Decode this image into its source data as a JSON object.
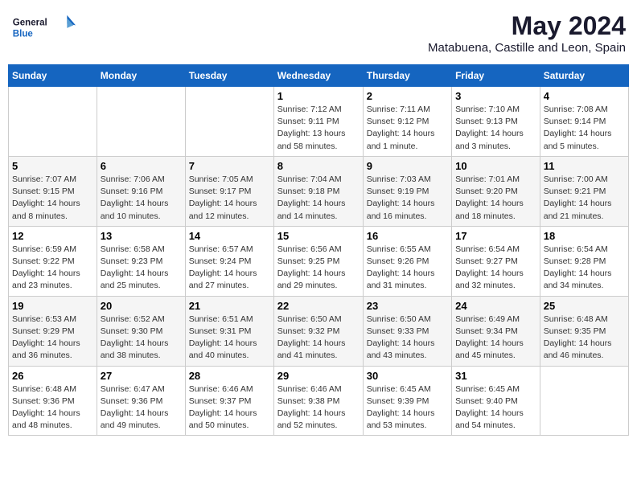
{
  "header": {
    "logo_general": "General",
    "logo_blue": "Blue",
    "title": "May 2024",
    "subtitle": "Matabuena, Castille and Leon, Spain"
  },
  "days_of_week": [
    "Sunday",
    "Monday",
    "Tuesday",
    "Wednesday",
    "Thursday",
    "Friday",
    "Saturday"
  ],
  "weeks": [
    [
      {
        "day": "",
        "sunrise": "",
        "sunset": "",
        "daylight": ""
      },
      {
        "day": "",
        "sunrise": "",
        "sunset": "",
        "daylight": ""
      },
      {
        "day": "",
        "sunrise": "",
        "sunset": "",
        "daylight": ""
      },
      {
        "day": "1",
        "sunrise": "Sunrise: 7:12 AM",
        "sunset": "Sunset: 9:11 PM",
        "daylight": "Daylight: 13 hours and 58 minutes."
      },
      {
        "day": "2",
        "sunrise": "Sunrise: 7:11 AM",
        "sunset": "Sunset: 9:12 PM",
        "daylight": "Daylight: 14 hours and 1 minute."
      },
      {
        "day": "3",
        "sunrise": "Sunrise: 7:10 AM",
        "sunset": "Sunset: 9:13 PM",
        "daylight": "Daylight: 14 hours and 3 minutes."
      },
      {
        "day": "4",
        "sunrise": "Sunrise: 7:08 AM",
        "sunset": "Sunset: 9:14 PM",
        "daylight": "Daylight: 14 hours and 5 minutes."
      }
    ],
    [
      {
        "day": "5",
        "sunrise": "Sunrise: 7:07 AM",
        "sunset": "Sunset: 9:15 PM",
        "daylight": "Daylight: 14 hours and 8 minutes."
      },
      {
        "day": "6",
        "sunrise": "Sunrise: 7:06 AM",
        "sunset": "Sunset: 9:16 PM",
        "daylight": "Daylight: 14 hours and 10 minutes."
      },
      {
        "day": "7",
        "sunrise": "Sunrise: 7:05 AM",
        "sunset": "Sunset: 9:17 PM",
        "daylight": "Daylight: 14 hours and 12 minutes."
      },
      {
        "day": "8",
        "sunrise": "Sunrise: 7:04 AM",
        "sunset": "Sunset: 9:18 PM",
        "daylight": "Daylight: 14 hours and 14 minutes."
      },
      {
        "day": "9",
        "sunrise": "Sunrise: 7:03 AM",
        "sunset": "Sunset: 9:19 PM",
        "daylight": "Daylight: 14 hours and 16 minutes."
      },
      {
        "day": "10",
        "sunrise": "Sunrise: 7:01 AM",
        "sunset": "Sunset: 9:20 PM",
        "daylight": "Daylight: 14 hours and 18 minutes."
      },
      {
        "day": "11",
        "sunrise": "Sunrise: 7:00 AM",
        "sunset": "Sunset: 9:21 PM",
        "daylight": "Daylight: 14 hours and 21 minutes."
      }
    ],
    [
      {
        "day": "12",
        "sunrise": "Sunrise: 6:59 AM",
        "sunset": "Sunset: 9:22 PM",
        "daylight": "Daylight: 14 hours and 23 minutes."
      },
      {
        "day": "13",
        "sunrise": "Sunrise: 6:58 AM",
        "sunset": "Sunset: 9:23 PM",
        "daylight": "Daylight: 14 hours and 25 minutes."
      },
      {
        "day": "14",
        "sunrise": "Sunrise: 6:57 AM",
        "sunset": "Sunset: 9:24 PM",
        "daylight": "Daylight: 14 hours and 27 minutes."
      },
      {
        "day": "15",
        "sunrise": "Sunrise: 6:56 AM",
        "sunset": "Sunset: 9:25 PM",
        "daylight": "Daylight: 14 hours and 29 minutes."
      },
      {
        "day": "16",
        "sunrise": "Sunrise: 6:55 AM",
        "sunset": "Sunset: 9:26 PM",
        "daylight": "Daylight: 14 hours and 31 minutes."
      },
      {
        "day": "17",
        "sunrise": "Sunrise: 6:54 AM",
        "sunset": "Sunset: 9:27 PM",
        "daylight": "Daylight: 14 hours and 32 minutes."
      },
      {
        "day": "18",
        "sunrise": "Sunrise: 6:54 AM",
        "sunset": "Sunset: 9:28 PM",
        "daylight": "Daylight: 14 hours and 34 minutes."
      }
    ],
    [
      {
        "day": "19",
        "sunrise": "Sunrise: 6:53 AM",
        "sunset": "Sunset: 9:29 PM",
        "daylight": "Daylight: 14 hours and 36 minutes."
      },
      {
        "day": "20",
        "sunrise": "Sunrise: 6:52 AM",
        "sunset": "Sunset: 9:30 PM",
        "daylight": "Daylight: 14 hours and 38 minutes."
      },
      {
        "day": "21",
        "sunrise": "Sunrise: 6:51 AM",
        "sunset": "Sunset: 9:31 PM",
        "daylight": "Daylight: 14 hours and 40 minutes."
      },
      {
        "day": "22",
        "sunrise": "Sunrise: 6:50 AM",
        "sunset": "Sunset: 9:32 PM",
        "daylight": "Daylight: 14 hours and 41 minutes."
      },
      {
        "day": "23",
        "sunrise": "Sunrise: 6:50 AM",
        "sunset": "Sunset: 9:33 PM",
        "daylight": "Daylight: 14 hours and 43 minutes."
      },
      {
        "day": "24",
        "sunrise": "Sunrise: 6:49 AM",
        "sunset": "Sunset: 9:34 PM",
        "daylight": "Daylight: 14 hours and 45 minutes."
      },
      {
        "day": "25",
        "sunrise": "Sunrise: 6:48 AM",
        "sunset": "Sunset: 9:35 PM",
        "daylight": "Daylight: 14 hours and 46 minutes."
      }
    ],
    [
      {
        "day": "26",
        "sunrise": "Sunrise: 6:48 AM",
        "sunset": "Sunset: 9:36 PM",
        "daylight": "Daylight: 14 hours and 48 minutes."
      },
      {
        "day": "27",
        "sunrise": "Sunrise: 6:47 AM",
        "sunset": "Sunset: 9:36 PM",
        "daylight": "Daylight: 14 hours and 49 minutes."
      },
      {
        "day": "28",
        "sunrise": "Sunrise: 6:46 AM",
        "sunset": "Sunset: 9:37 PM",
        "daylight": "Daylight: 14 hours and 50 minutes."
      },
      {
        "day": "29",
        "sunrise": "Sunrise: 6:46 AM",
        "sunset": "Sunset: 9:38 PM",
        "daylight": "Daylight: 14 hours and 52 minutes."
      },
      {
        "day": "30",
        "sunrise": "Sunrise: 6:45 AM",
        "sunset": "Sunset: 9:39 PM",
        "daylight": "Daylight: 14 hours and 53 minutes."
      },
      {
        "day": "31",
        "sunrise": "Sunrise: 6:45 AM",
        "sunset": "Sunset: 9:40 PM",
        "daylight": "Daylight: 14 hours and 54 minutes."
      },
      {
        "day": "",
        "sunrise": "",
        "sunset": "",
        "daylight": ""
      }
    ]
  ]
}
